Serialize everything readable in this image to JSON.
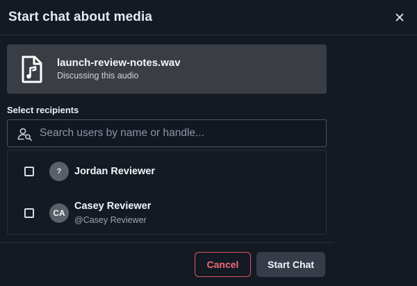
{
  "dialog": {
    "title": "Start chat about media",
    "close_icon": "close-icon"
  },
  "media": {
    "icon": "audio-file-icon",
    "filename": "launch-review-notes.wav",
    "subtitle": "Discussing this audio"
  },
  "recipients": {
    "label": "Select recipients",
    "search_placeholder": "Search users by name or handle...",
    "search_value": "",
    "search_icon": "user-search-icon",
    "users": [
      {
        "avatar": "?",
        "name": "Jordan Reviewer",
        "handle": "",
        "checked": false
      },
      {
        "avatar": "CA",
        "name": "Casey Reviewer",
        "handle": "@Casey Reviewer",
        "checked": false
      }
    ]
  },
  "footer": {
    "cancel_label": "Cancel",
    "start_label": "Start Chat"
  },
  "colors": {
    "background": "#131a23",
    "card": "#3a3d44",
    "cancel_accent": "#ef6b75",
    "start_button": "#363d49",
    "avatar": "#5b6068"
  }
}
